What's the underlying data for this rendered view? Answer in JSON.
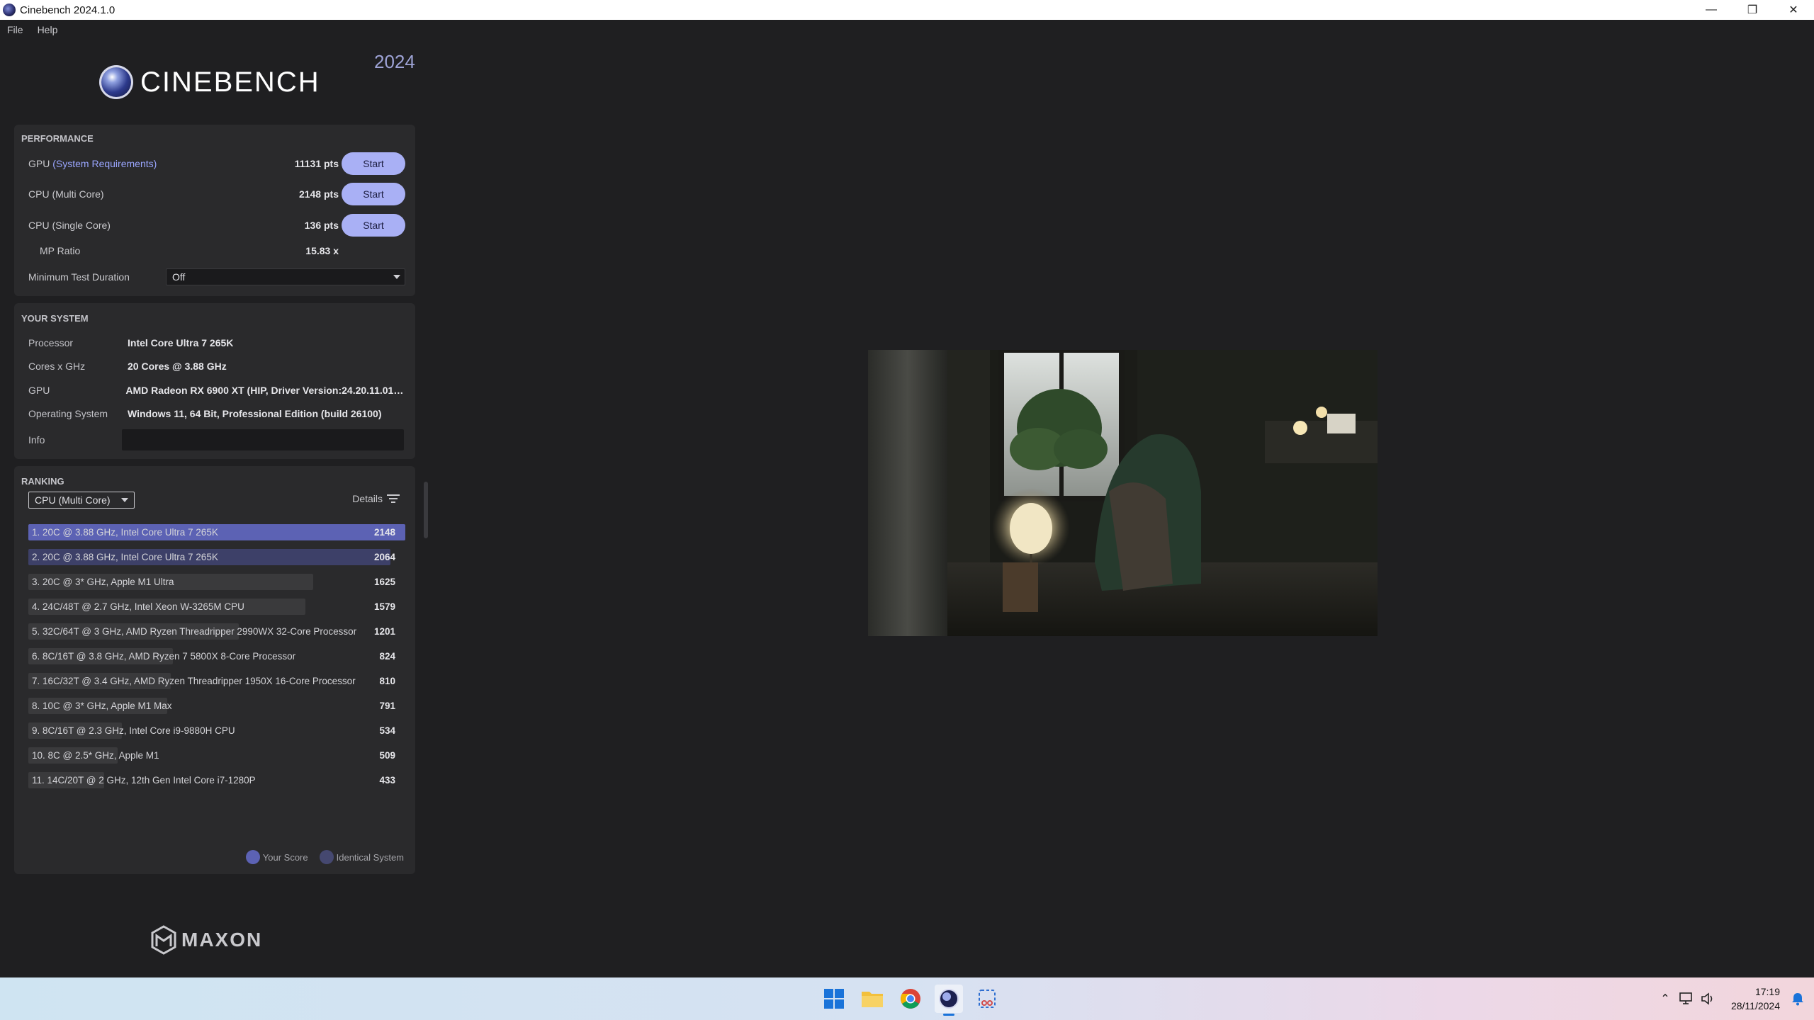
{
  "window": {
    "title": "Cinebench 2024.1.0"
  },
  "menu": [
    "File",
    "Help"
  ],
  "brand": {
    "logo_text": "CINEBENCH",
    "year": "2024",
    "footer_logo": "MAXON"
  },
  "performance": {
    "title": "PERFORMANCE",
    "gpu_label_prefix": "GPU",
    "gpu_link": "(System Requirements)",
    "gpu_pts": "11131 pts",
    "cpu_multi_label": "CPU (Multi Core)",
    "cpu_multi_pts": "2148 pts",
    "cpu_single_label": "CPU (Single Core)",
    "cpu_single_pts": "136 pts",
    "start_label": "Start",
    "mp_label": "MP Ratio",
    "mp_value": "15.83 x",
    "min_duration_label": "Minimum Test Duration",
    "min_duration_value": "Off"
  },
  "system": {
    "title": "YOUR SYSTEM",
    "rows": [
      {
        "k": "Processor",
        "v": "Intel Core Ultra 7 265K"
      },
      {
        "k": "Cores x GHz",
        "v": "20 Cores @ 3.88 GHz"
      },
      {
        "k": "GPU",
        "v": "AMD Radeon RX 6900 XT (HIP, Driver Version:24.20.11.01-2..."
      },
      {
        "k": "Operating System",
        "v": "Windows 11, 64 Bit, Professional Edition (build 26100)"
      }
    ],
    "info_label": "Info"
  },
  "ranking": {
    "title": "RANKING",
    "selector": "CPU (Multi Core)",
    "details_label": "Details",
    "max_score": 2148,
    "colors": {
      "yours": "#5c62b4",
      "identical": "#3d4068",
      "other": "#3a3a3c"
    },
    "items": [
      {
        "label": "1. 20C @ 3.88 GHz, Intel Core Ultra 7 265K",
        "score": 2148,
        "kind": "yours"
      },
      {
        "label": "2. 20C @ 3.88 GHz, Intel Core Ultra 7 265K",
        "score": 2064,
        "kind": "identical"
      },
      {
        "label": "3. 20C @ 3* GHz, Apple M1 Ultra",
        "score": 1625,
        "kind": "other"
      },
      {
        "label": "4. 24C/48T @ 2.7 GHz, Intel Xeon W-3265M CPU",
        "score": 1579,
        "kind": "other"
      },
      {
        "label": "5. 32C/64T @ 3 GHz, AMD Ryzen Threadripper 2990WX 32-Core Processor",
        "score": 1201,
        "kind": "other"
      },
      {
        "label": "6. 8C/16T @ 3.8 GHz, AMD Ryzen 7 5800X 8-Core Processor",
        "score": 824,
        "kind": "other"
      },
      {
        "label": "7. 16C/32T @ 3.4 GHz, AMD Ryzen Threadripper 1950X 16-Core Processor",
        "score": 810,
        "kind": "other"
      },
      {
        "label": "8. 10C @ 3* GHz, Apple M1 Max",
        "score": 791,
        "kind": "other"
      },
      {
        "label": "9. 8C/16T @ 2.3 GHz, Intel Core i9-9880H CPU",
        "score": 534,
        "kind": "other"
      },
      {
        "label": "10. 8C @ 2.5* GHz, Apple M1",
        "score": 509,
        "kind": "other"
      },
      {
        "label": "11. 14C/20T @ 2 GHz, 12th Gen Intel Core i7-1280P",
        "score": 433,
        "kind": "other"
      }
    ],
    "legend": {
      "yours": "Your Score",
      "identical": "Identical System"
    }
  },
  "taskbar": {
    "apps": [
      "windows-start-icon",
      "file-explorer-icon",
      "chrome-icon",
      "cinebench-icon",
      "snipping-tool-icon"
    ],
    "time": "17:19",
    "date": "28/11/2024"
  }
}
